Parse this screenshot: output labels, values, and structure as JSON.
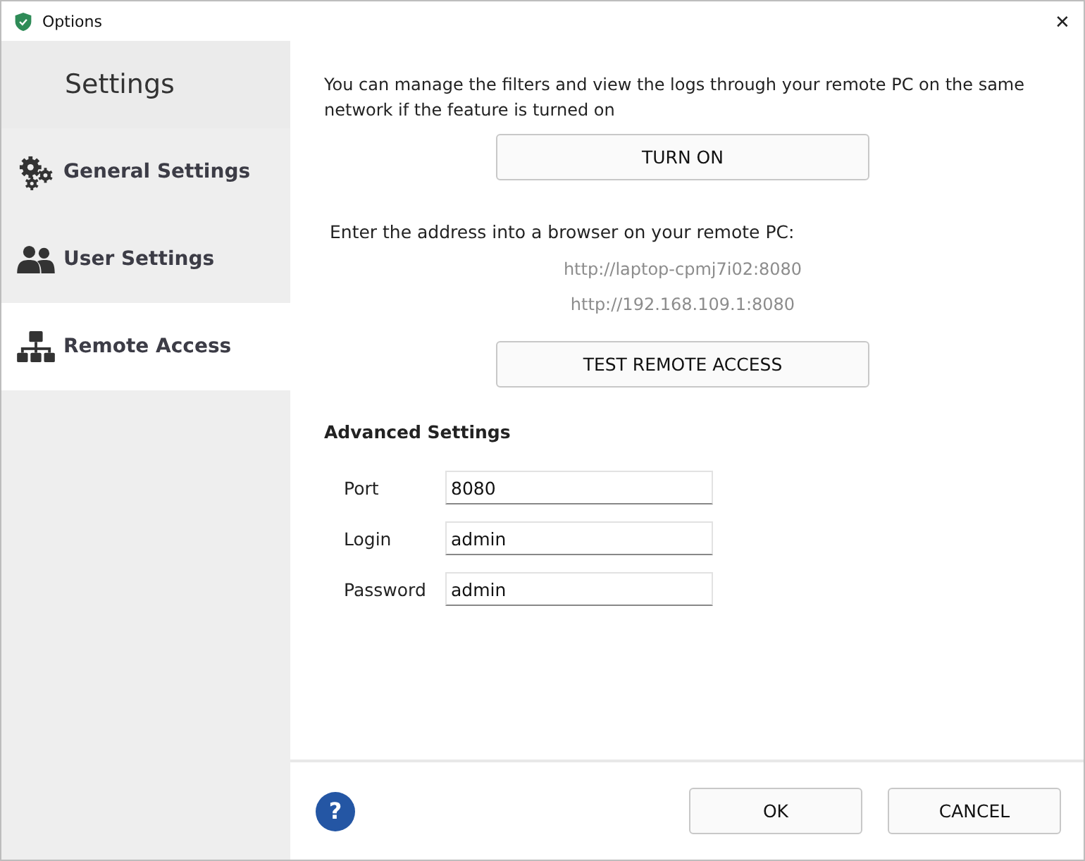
{
  "window": {
    "title": "Options",
    "close": "✕"
  },
  "sidebar": {
    "title": "Settings",
    "items": [
      {
        "label": "General Settings",
        "kind": "gears",
        "selected": false
      },
      {
        "label": "User Settings",
        "kind": "users",
        "selected": false
      },
      {
        "label": "Remote Access",
        "kind": "network",
        "selected": true
      }
    ]
  },
  "content": {
    "intro": "You can manage the filters and view the logs through your remote PC on the same network if the feature is turned on",
    "turn_on_button": "TURN ON",
    "address_hint": "Enter the address into a browser on your remote PC:",
    "addresses": [
      "http://laptop-cpmj7i02:8080",
      "http://192.168.109.1:8080"
    ],
    "test_button": "TEST REMOTE ACCESS",
    "advanced_title": "Advanced Settings",
    "fields": [
      {
        "label": "Port",
        "value": "8080"
      },
      {
        "label": "Login",
        "value": "admin"
      },
      {
        "label": "Password",
        "value": "admin"
      }
    ]
  },
  "footer": {
    "help": "?",
    "buttons": [
      "OK",
      "CANCEL"
    ]
  }
}
